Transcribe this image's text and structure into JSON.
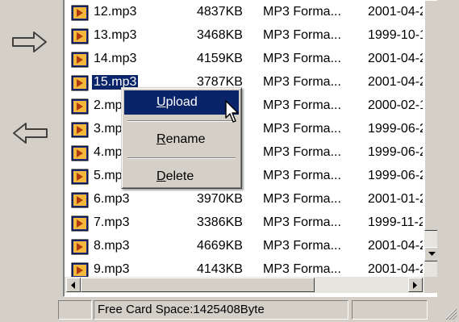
{
  "files": [
    {
      "name": "12.mp3",
      "size": "4837KB",
      "type": "MP3 Forma...",
      "date": "2001-04-2"
    },
    {
      "name": "13.mp3",
      "size": "3468KB",
      "type": "MP3 Forma...",
      "date": "1999-10-1"
    },
    {
      "name": "14.mp3",
      "size": "4159KB",
      "type": "MP3 Forma...",
      "date": "2001-04-2"
    },
    {
      "name": "15.mp3",
      "size": "3787KB",
      "type": "MP3 Forma...",
      "date": "2001-04-2"
    },
    {
      "name": "2.mp3",
      "size": "",
      "type": "MP3 Forma...",
      "date": "2000-02-1"
    },
    {
      "name": "3.mp3",
      "size": "",
      "type": "MP3 Forma...",
      "date": "1999-06-2"
    },
    {
      "name": "4.mp3",
      "size": "",
      "type": "MP3 Forma...",
      "date": "1999-06-2"
    },
    {
      "name": "5.mp3",
      "size": "",
      "type": "MP3 Forma...",
      "date": "1999-06-2"
    },
    {
      "name": "6.mp3",
      "size": "3970KB",
      "type": "MP3 Forma...",
      "date": "2001-01-2"
    },
    {
      "name": "7.mp3",
      "size": "3386KB",
      "type": "MP3 Forma...",
      "date": "1999-11-2"
    },
    {
      "name": "8.mp3",
      "size": "4669KB",
      "type": "MP3 Forma...",
      "date": "2001-04-2"
    },
    {
      "name": "9.mp3",
      "size": "4143KB",
      "type": "MP3 Forma...",
      "date": "2001-04-2"
    }
  ],
  "selected_index": 3,
  "context_menu": {
    "upload": {
      "accel": "U",
      "rest": "pload"
    },
    "rename": {
      "accel": "R",
      "rest": "ename"
    },
    "delete": {
      "accel": "D",
      "rest": "elete"
    }
  },
  "status": {
    "free_space": "Free Card Space:1425408Byte"
  },
  "colors": {
    "selection": "#0a246a",
    "face": "#d4d0c8"
  },
  "icons": {
    "transfer_right": "arrow-right-icon",
    "transfer_left": "arrow-left-icon",
    "file": "mp3-file-icon"
  }
}
